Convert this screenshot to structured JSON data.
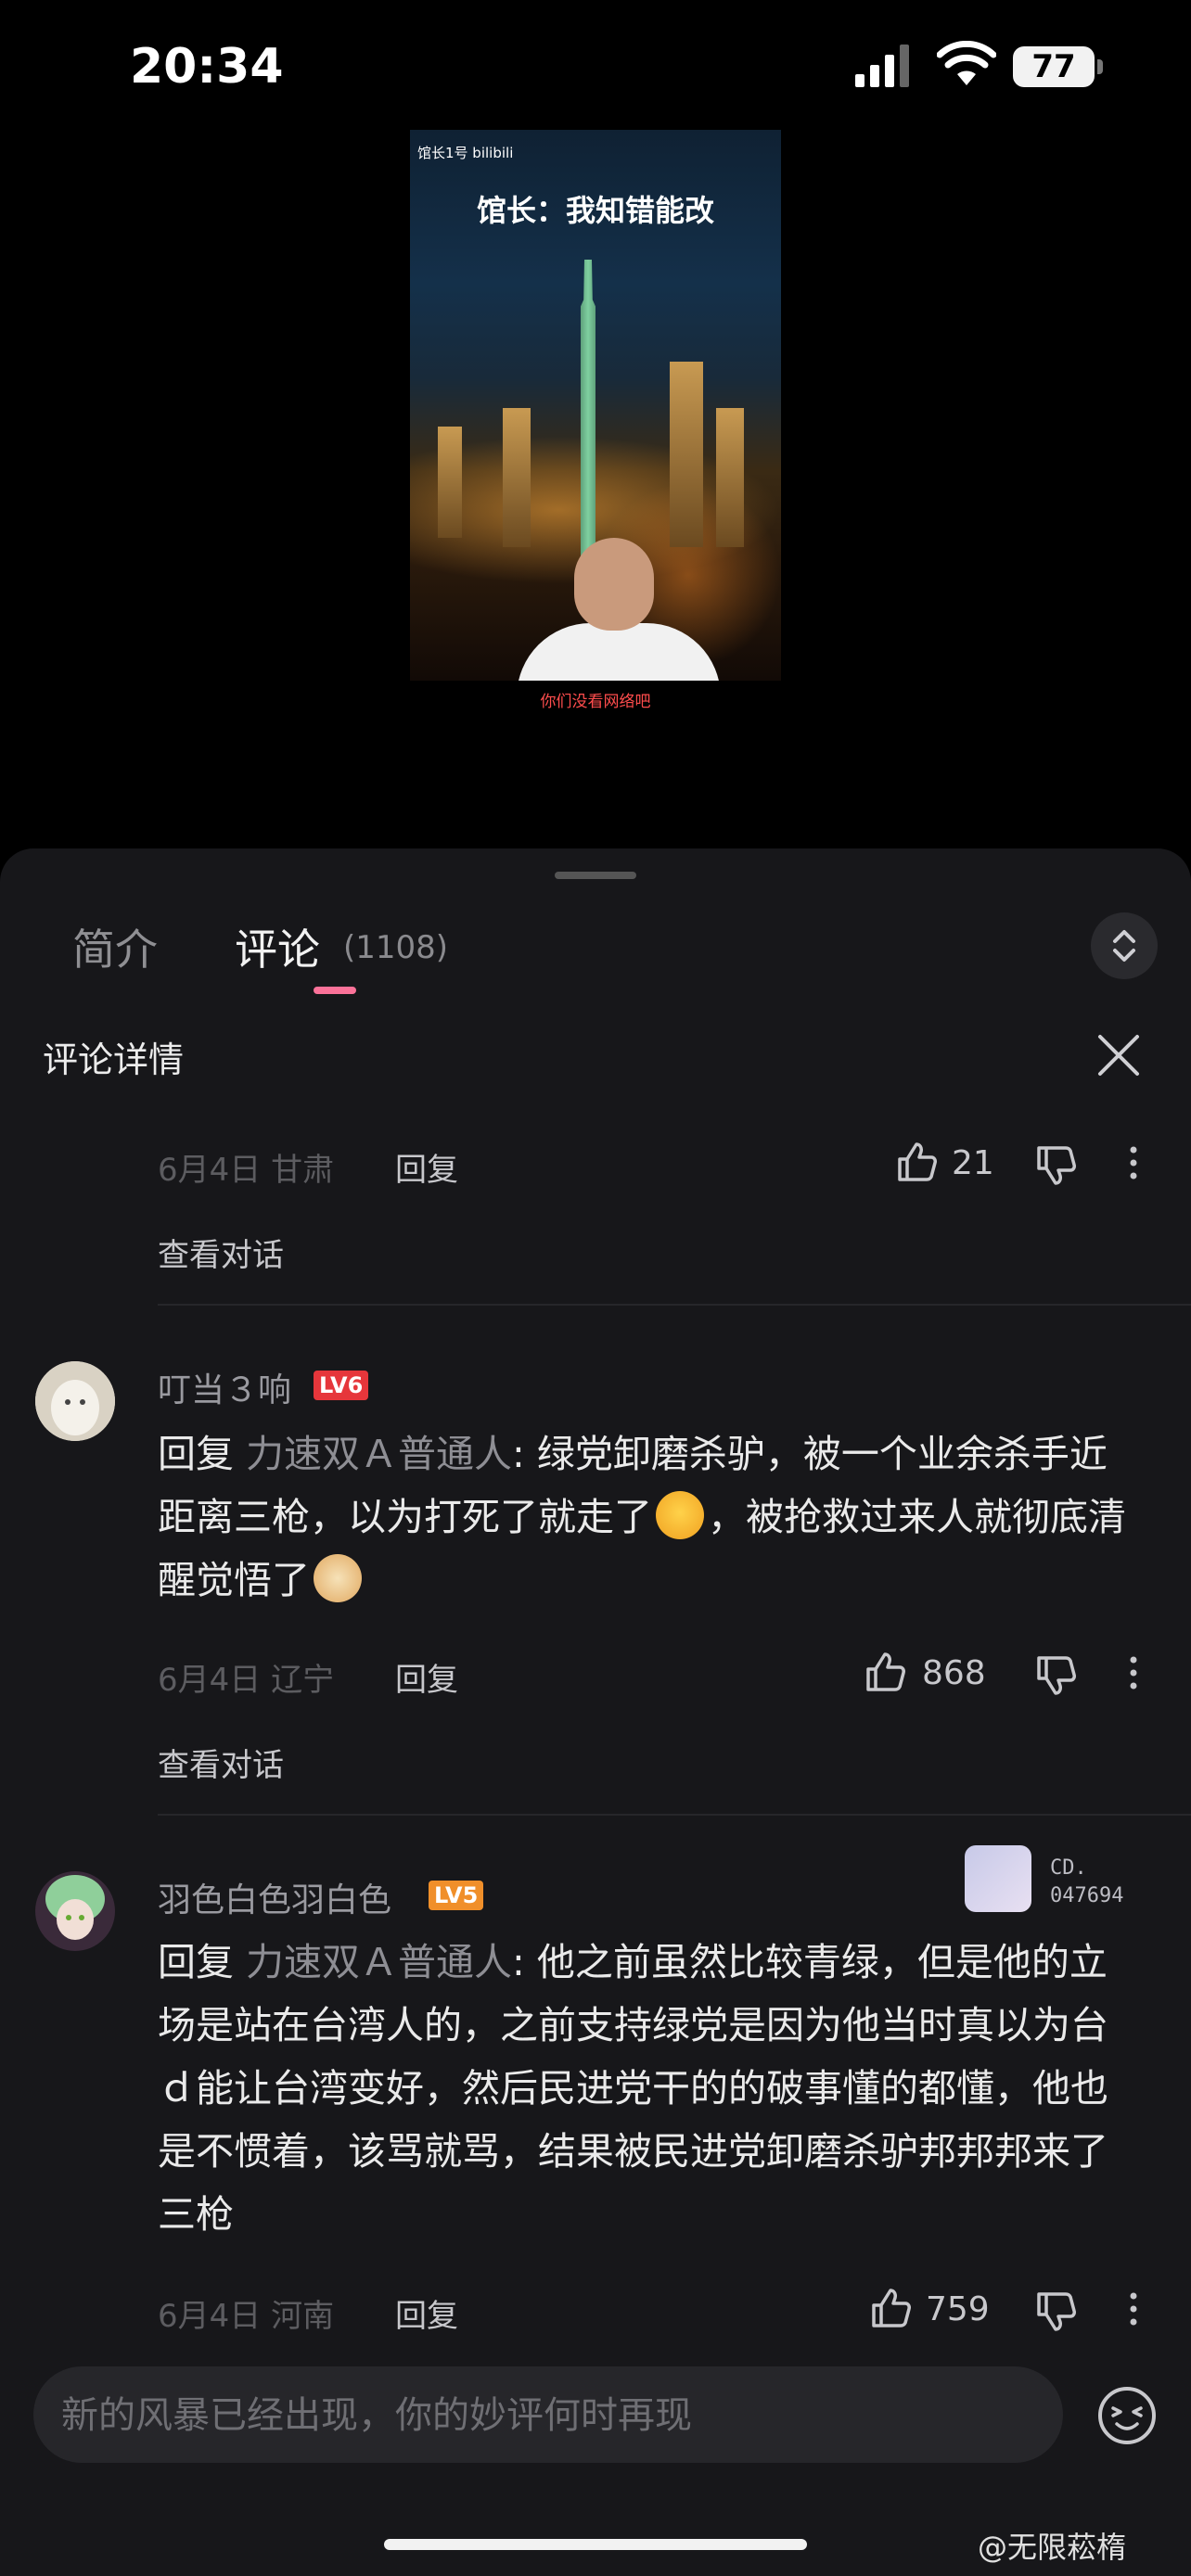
{
  "status_bar": {
    "time": "20:34",
    "battery": "77"
  },
  "video": {
    "uploader_tag": "馆长1号 bilibili",
    "title_overlay": "馆长：我知错能改",
    "caption": "你们没看网络吧"
  },
  "tabs": {
    "intro": "简介",
    "comments": "评论",
    "comment_count": "(1108)"
  },
  "panel": {
    "title": "评论详情"
  },
  "comments": [
    {
      "meta": "6月4日 甘肃",
      "reply_label": "回复",
      "likes": "21",
      "view_conversation": "查看对话"
    },
    {
      "username": "叮当３响",
      "level": "LV6",
      "reply_prefix": "回复",
      "mention": "力速双Ａ普通人",
      "text_part1": ": 绿党卸磨杀驴，被一个业余杀手近距离三枪，以为打死了就走了",
      "text_part2": "，被抢救过来人就彻底清醒觉悟了",
      "meta": "6月4日 辽宁",
      "reply_label": "回复",
      "likes": "868",
      "view_conversation": "查看对话"
    },
    {
      "username": "羽色白色羽白色",
      "level": "LV5",
      "badge_line1": "CD.",
      "badge_line2": "047694",
      "reply_prefix": "回复",
      "mention": "力速双Ａ普通人",
      "text": ": 他之前虽然比较青绿，但是他的立场是站在台湾人的，之前支持绿党是因为他当时真以为台ｄ能让台湾变好，然后民进党干的的破事懂的都懂，他也是不惯着，该骂就骂，结果被民进党卸磨杀驴邦邦邦来了三枪",
      "meta": "6月4日 河南",
      "reply_label": "回复",
      "likes": "759"
    }
  ],
  "input": {
    "placeholder": "新的风暴已经出现，你的妙评何时再现"
  },
  "watermark": "@无限菘楕",
  "icons": [
    "thumb-up-icon",
    "thumb-down-icon",
    "more-icon",
    "close-icon",
    "expand-icon",
    "emoji-icon",
    "wifi-icon",
    "signal-icon"
  ]
}
